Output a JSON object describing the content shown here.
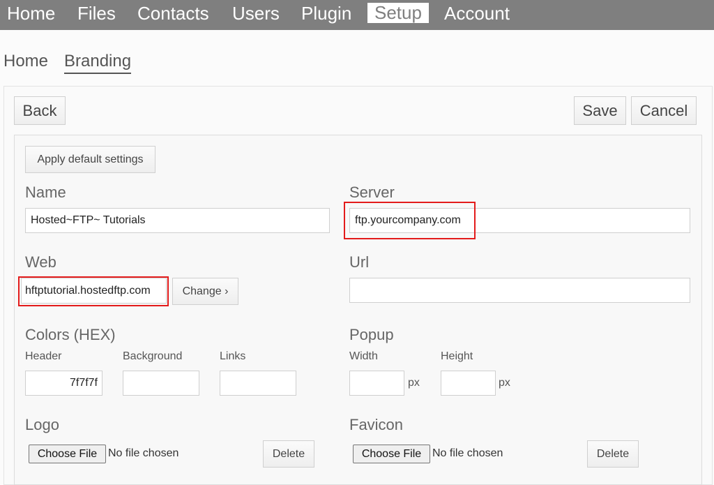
{
  "nav": {
    "items": [
      "Home",
      "Files",
      "Contacts",
      "Users",
      "Plugin",
      "Setup",
      "Account"
    ],
    "active": "Setup"
  },
  "breadcrumb": {
    "home": "Home",
    "current": "Branding"
  },
  "toolbar": {
    "back": "Back",
    "save": "Save",
    "cancel": "Cancel"
  },
  "form": {
    "apply_default": "Apply default settings",
    "name": {
      "label": "Name",
      "value": "Hosted~FTP~ Tutorials"
    },
    "server": {
      "label": "Server",
      "value": "ftp.yourcompany.com"
    },
    "web": {
      "label": "Web",
      "value": "hftptutorial.hostedftp.com",
      "change_button": "Change ›"
    },
    "url": {
      "label": "Url",
      "value": ""
    },
    "colors": {
      "label": "Colors (HEX)",
      "header_label": "Header",
      "header_value": "7f7f7f",
      "background_label": "Background",
      "background_value": "",
      "links_label": "Links",
      "links_value": ""
    },
    "popup": {
      "label": "Popup",
      "width_label": "Width",
      "width_value": "",
      "width_unit": "px",
      "height_label": "Height",
      "height_value": "",
      "height_unit": "px"
    },
    "logo": {
      "label": "Logo",
      "choose": "Choose File",
      "status": "No file chosen",
      "delete": "Delete"
    },
    "favicon": {
      "label": "Favicon",
      "choose": "Choose File",
      "status": "No file chosen",
      "delete": "Delete"
    }
  },
  "colors": {
    "nav_bg": "#7f7f7f",
    "highlight": "#e31b1b"
  }
}
